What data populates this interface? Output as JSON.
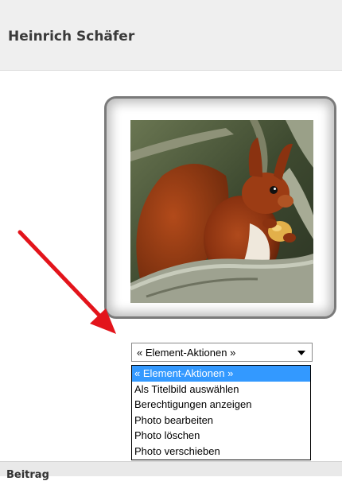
{
  "header": {
    "title": "Heinrich Schäfer"
  },
  "photo": {
    "subject": "squirrel-photo"
  },
  "annotation": {
    "arrow_color": "#e3141b"
  },
  "actions_select": {
    "value": "« Element-Aktionen »",
    "options": [
      "« Element-Aktionen »",
      "Als Titelbild auswählen",
      "Berechtigungen anzeigen",
      "Photo bearbeiten",
      "Photo löschen",
      "Photo verschieben"
    ],
    "highlighted_index": 0,
    "highlight_color": "#3399ff"
  },
  "footer": {
    "label": "Beitrag"
  }
}
